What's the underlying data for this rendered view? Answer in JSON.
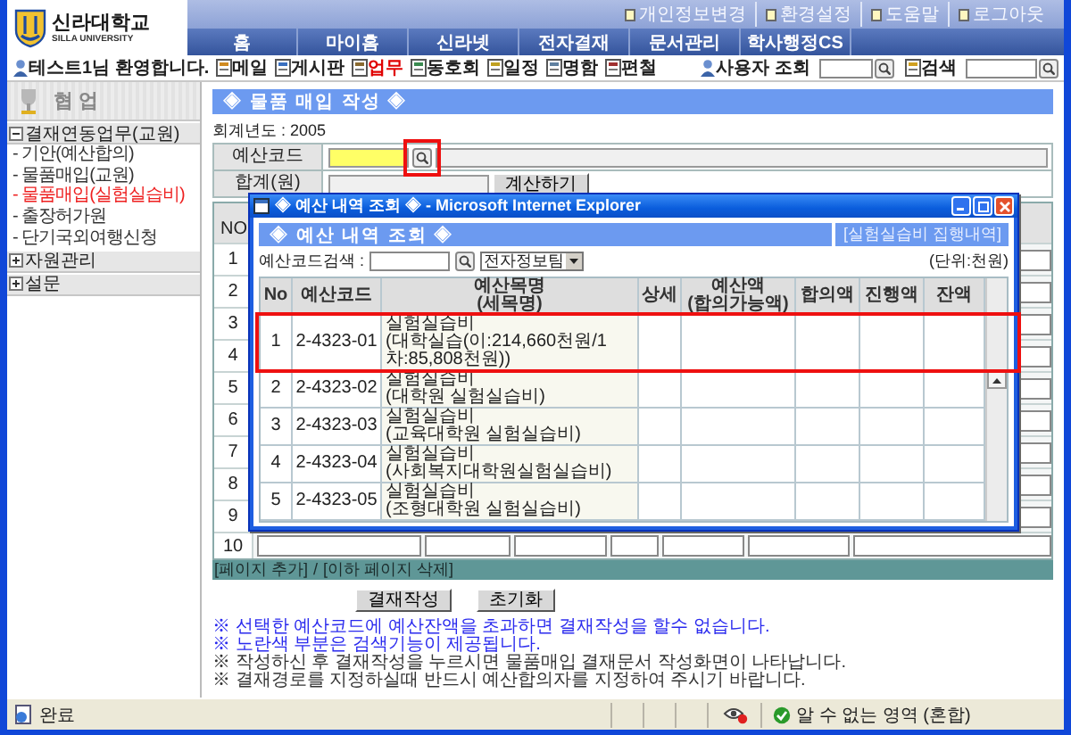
{
  "header": {
    "logo_title": "신라대학교",
    "logo_subtitle": "SILLA UNIVERSITY",
    "top_links": [
      "개인정보변경",
      "환경설정",
      "도움말",
      "로그아웃"
    ],
    "nav_tabs": [
      {
        "label": "홈",
        "selected": false
      },
      {
        "label": "마이홈",
        "selected": false
      },
      {
        "label": "신라넷",
        "selected": false
      },
      {
        "label": "전자결재",
        "selected": false
      },
      {
        "label": "문서관리",
        "selected": false
      },
      {
        "label": "학사행정CS",
        "selected": false
      }
    ]
  },
  "toolbar": {
    "welcome": "테스트1님 환영합니다.",
    "menu": [
      {
        "label": "메일",
        "selected": false
      },
      {
        "label": "게시판",
        "selected": false
      },
      {
        "label": "업무",
        "selected": true
      },
      {
        "label": "동호회",
        "selected": false
      },
      {
        "label": "일정",
        "selected": false
      },
      {
        "label": "명함",
        "selected": false
      },
      {
        "label": "편철",
        "selected": false
      }
    ],
    "user_search_label": "사용자 조회",
    "search_label": "검색"
  },
  "sidebar": {
    "title": "협업",
    "tree": [
      {
        "label": "결재연동업무(교원)",
        "expanded": true,
        "children": [
          {
            "label": "- 기안(예산합의)",
            "selected": false
          },
          {
            "label": "- 물품매입(교원)",
            "selected": false
          },
          {
            "label": "- 물품매입(실험실습비)",
            "selected": true
          },
          {
            "label": "- 출장허가원",
            "selected": false
          },
          {
            "label": "- 단기국외여행신청",
            "selected": false
          }
        ]
      },
      {
        "label": "자원관리",
        "expanded": false
      },
      {
        "label": "설문",
        "expanded": false
      }
    ]
  },
  "form": {
    "title": "◈ 물품 매입 작성 ◈",
    "fiscal_year": "회계년도 : 2005",
    "budget_code_label": "예산코드",
    "total_label": "합계(원)",
    "calculate_button": "계산하기"
  },
  "items_table": {
    "header": "NO",
    "rows": [
      "1",
      "2",
      "3",
      "4",
      "5",
      "6",
      "7",
      "8",
      "9",
      "10"
    ]
  },
  "page_links": [
    "[페이지 추가]",
    "[이하 페이지 삭제]"
  ],
  "page_links_separator": "/",
  "buttons": [
    "결재작성",
    "초기화"
  ],
  "notes": [
    {
      "text": "※ 선택한 예산코드에 예산잔액을 초과하면 결재작성을 할수 없습니다.",
      "color": "#2a2aee"
    },
    {
      "text": "※ 노란색 부분은 검색기능이 제공됩니다.",
      "color": "#2a2aee"
    },
    {
      "text": "※ 작성하신 후 결재작성을 누르시면 물품매입 결재문서 작성화면이 나타납니다.",
      "color": "#333333"
    },
    {
      "text": "※ 결재경로를 지정하실때 반드시 예산합의자를 지정하여 주시기 바랍니다.",
      "color": "#333333"
    }
  ],
  "popup": {
    "window_title": "◈ 예산 내역 조회 ◈ - Microsoft Internet Explorer",
    "heading": "◈ 예산 내역 조회 ◈",
    "link": "[실험실습비 집행내역]",
    "unit": "(단위:천원)",
    "search_label": "예산코드검색 :",
    "dropdown_value": "전자정보팀",
    "columns": [
      "No",
      "예산코드",
      "예산목명\n(세목명)",
      "상세",
      "예산액\n(합의가능액)",
      "합의액",
      "진행액",
      "잔액"
    ],
    "rows": [
      {
        "no": "1",
        "code": "2-4323-01",
        "name": "실험실습비",
        "detail": "(대학실습(이:214,660천원/1차:85,808천원))"
      },
      {
        "no": "2",
        "code": "2-4323-02",
        "name": "실험실습비",
        "detail": "(대학원 실험실습비)"
      },
      {
        "no": "3",
        "code": "2-4323-03",
        "name": "실험실습비",
        "detail": "(교육대학원 실험실습비)"
      },
      {
        "no": "4",
        "code": "2-4323-04",
        "name": "실험실습비",
        "detail": "(사회복지대학원실험실습비)"
      },
      {
        "no": "5",
        "code": "2-4323-05",
        "name": "실험실습비",
        "detail": "(조형대학원 실험실습비)"
      }
    ]
  },
  "status_bar": {
    "text": "완료",
    "zone": "알 수 없는 영역 (혼합)"
  }
}
